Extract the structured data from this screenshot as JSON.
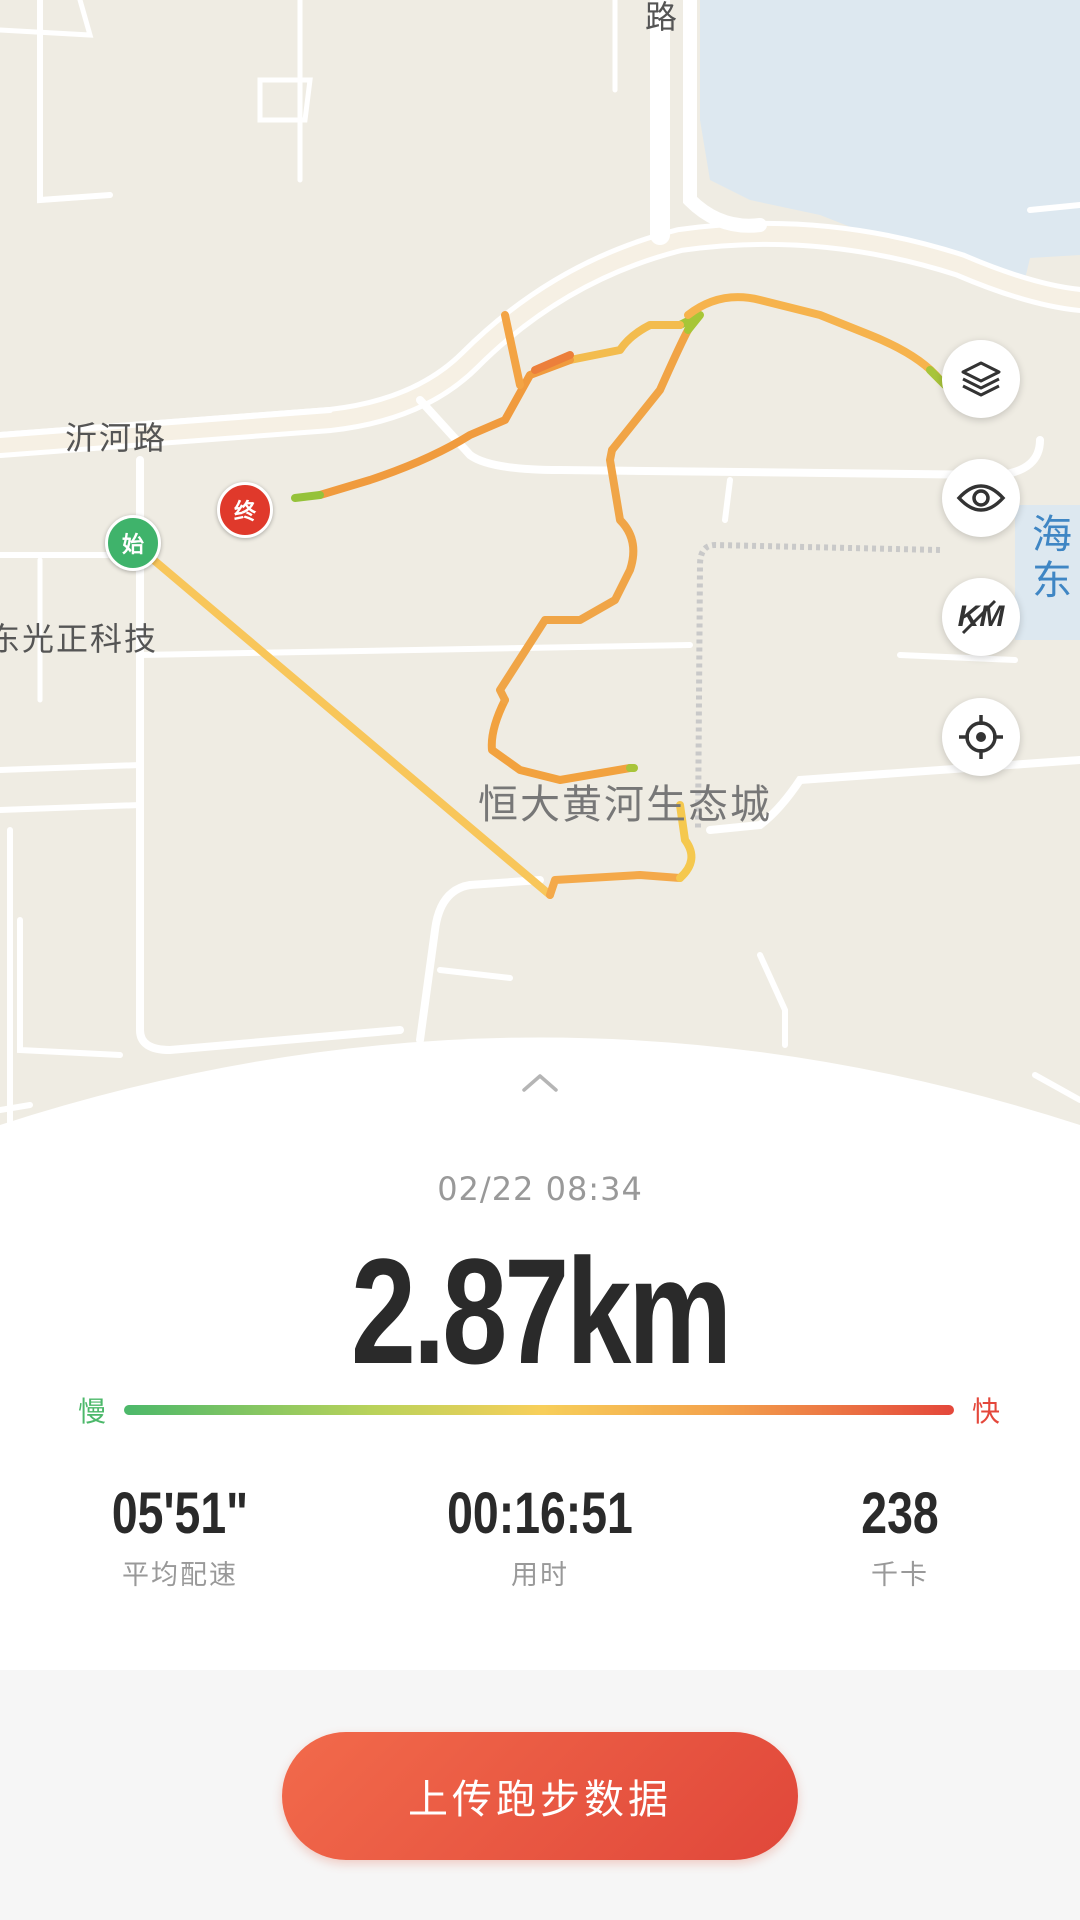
{
  "map": {
    "labels": {
      "top_road": "路",
      "yihe_road": "沂河路",
      "company": "东光正科技",
      "community": "恒大黄河生态城",
      "water_line1": "海",
      "water_line2": "东"
    },
    "markers": {
      "start": "始",
      "end": "终"
    },
    "controls": [
      "layers-icon",
      "eye-icon",
      "km-toggle-icon",
      "locate-icon"
    ],
    "km_icon_text": "KM",
    "colors": {
      "land": "#efece3",
      "water": "#dde8f0",
      "road": "#ffffff",
      "start": "#3fb36b",
      "end": "#e0392b"
    }
  },
  "summary": {
    "datetime": "02/22 08:34",
    "distance": "2.87km",
    "legend": {
      "slow": "慢",
      "fast": "快"
    },
    "stats": [
      {
        "value": "05'51\"",
        "label": "平均配速"
      },
      {
        "value": "00:16:51",
        "label": "用时"
      },
      {
        "value": "238",
        "label": "千卡"
      }
    ]
  },
  "actions": {
    "upload_label": "上传跑步数据"
  },
  "colors": {
    "slow": "#4cb86a",
    "mid": "#f7cf5a",
    "fast": "#e4473b",
    "button_start": "#f26a4b",
    "button_end": "#e0473a"
  }
}
